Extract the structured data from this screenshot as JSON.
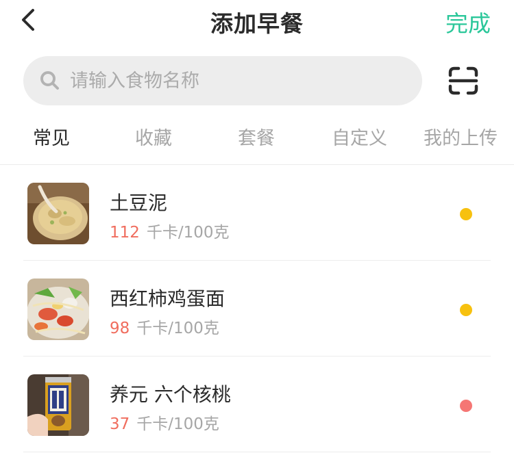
{
  "header": {
    "title": "添加早餐",
    "done_label": "完成"
  },
  "search": {
    "placeholder": "请输入食物名称"
  },
  "tabs": [
    {
      "label": "常见",
      "active": true
    },
    {
      "label": "收藏",
      "active": false
    },
    {
      "label": "套餐",
      "active": false
    },
    {
      "label": "自定义",
      "active": false
    },
    {
      "label": "我的上传",
      "active": false
    }
  ],
  "foods": [
    {
      "name": "土豆泥",
      "calories": "112",
      "unit": "千卡/100克",
      "dot_color": "#f7c10f",
      "thumbnail": "mashed-potato-photo"
    },
    {
      "name": "西红柿鸡蛋面",
      "calories": "98",
      "unit": "千卡/100克",
      "dot_color": "#f7c10f",
      "thumbnail": "tomato-egg-noodle-photo"
    },
    {
      "name": "养元 六个核桃",
      "calories": "37",
      "unit": "千卡/100克",
      "dot_color": "#f57674",
      "thumbnail": "walnut-drink-can-photo"
    }
  ],
  "colors": {
    "accent": "#2bc79a",
    "calorie_number": "#f06d5e"
  }
}
